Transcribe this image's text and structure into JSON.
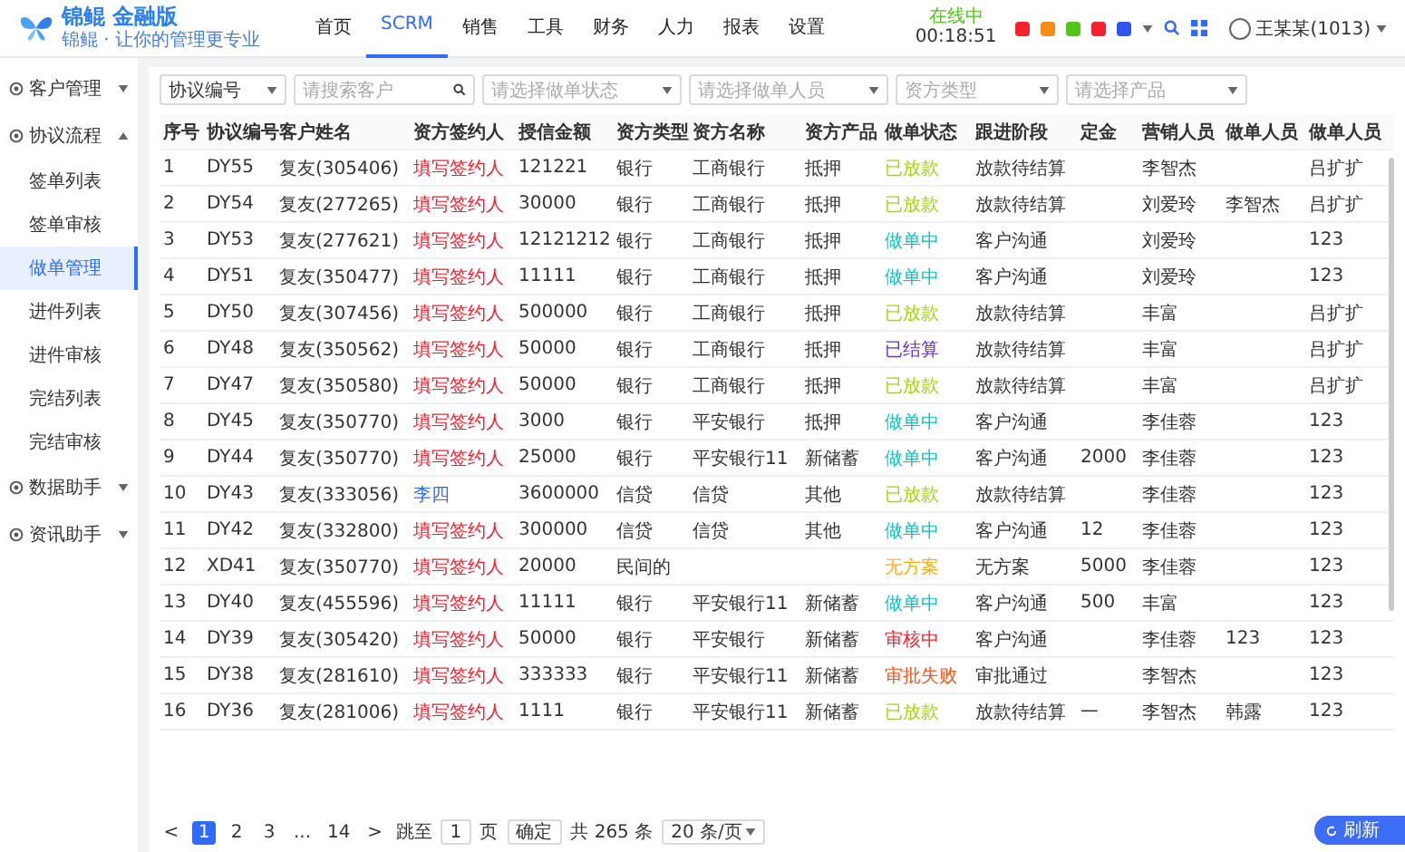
{
  "header": {
    "logo": {
      "name": "锦鲲",
      "edition": "金融版",
      "slogan": "锦鲲 · 让你的管理更专业"
    },
    "nav": [
      {
        "label": "首页",
        "selected": false
      },
      {
        "label": "SCRM",
        "selected": true
      },
      {
        "label": "销售",
        "selected": false
      },
      {
        "label": "工具",
        "selected": false
      },
      {
        "label": "财务",
        "selected": false
      },
      {
        "label": "人力",
        "selected": false
      },
      {
        "label": "报表",
        "selected": false
      },
      {
        "label": "设置",
        "selected": false
      }
    ],
    "status": {
      "label": "在线中",
      "time": "00:18:51"
    },
    "quick_icons": [
      {
        "color": "#f5222d"
      },
      {
        "color": "#fa8c16"
      },
      {
        "color": "#52c41a"
      },
      {
        "color": "#f5222d"
      },
      {
        "color": "#2f54eb"
      }
    ],
    "user": "王某某(1013)"
  },
  "sidebar": [
    {
      "label": "客户管理",
      "expanded": false
    },
    {
      "label": "协议流程",
      "expanded": true,
      "children": [
        {
          "label": "签单列表",
          "selected": false
        },
        {
          "label": "签单审核",
          "selected": false
        },
        {
          "label": "做单管理",
          "selected": true
        },
        {
          "label": "进件列表",
          "selected": false
        },
        {
          "label": "进件审核",
          "selected": false
        },
        {
          "label": "完结列表",
          "selected": false
        },
        {
          "label": "完结审核",
          "selected": false
        }
      ]
    },
    {
      "label": "数据助手",
      "expanded": false
    },
    {
      "label": "资讯助手",
      "expanded": false
    }
  ],
  "filters": [
    {
      "kind": "select",
      "value": "协议编号"
    },
    {
      "kind": "search",
      "placeholder": "请搜索客户"
    },
    {
      "kind": "select",
      "placeholder": "请选择做单状态"
    },
    {
      "kind": "select",
      "placeholder": "请选择做单人员"
    },
    {
      "kind": "select",
      "placeholder": "资方类型"
    },
    {
      "kind": "select",
      "placeholder": "请选择产品"
    }
  ],
  "table": {
    "columns": [
      "序号",
      "协议编号",
      "客户姓名",
      "资方签约人",
      "授信金额",
      "资方类型",
      "资方名称",
      "资方产品",
      "做单状态",
      "跟进阶段",
      "定金",
      "营销人员",
      "做单人员",
      "做单人员"
    ],
    "rows": [
      {
        "cells": [
          "1",
          "DY55",
          "复友(305406)",
          "填写签约人",
          "121221",
          "银行",
          "工商银行",
          "抵押",
          "已放款",
          "放款待结算",
          "",
          "李智杰",
          "",
          "吕扩扩"
        ],
        "signer_filled": false,
        "color": "#a0d911"
      },
      {
        "cells": [
          "2",
          "DY54",
          "复友(277265)",
          "填写签约人",
          "30000",
          "银行",
          "工商银行",
          "抵押",
          "已放款",
          "放款待结算",
          "",
          "刘爱玲",
          "李智杰",
          "吕扩扩"
        ],
        "signer_filled": false,
        "color": "#a0d911"
      },
      {
        "cells": [
          "3",
          "DY53",
          "复友(277621)",
          "填写签约人",
          "12121212",
          "银行",
          "工商银行",
          "抵押",
          "做单中",
          "客户沟通",
          "",
          "刘爱玲",
          "",
          "123"
        ],
        "signer_filled": false,
        "color": "#13c2c2"
      },
      {
        "cells": [
          "4",
          "DY51",
          "复友(350477)",
          "填写签约人",
          "11111",
          "银行",
          "工商银行",
          "抵押",
          "做单中",
          "客户沟通",
          "",
          "刘爱玲",
          "",
          "123"
        ],
        "signer_filled": false,
        "color": "#13c2c2"
      },
      {
        "cells": [
          "5",
          "DY50",
          "复友(307456)",
          "填写签约人",
          "500000",
          "银行",
          "工商银行",
          "抵押",
          "已放款",
          "放款待结算",
          "",
          "丰富",
          "",
          "吕扩扩"
        ],
        "signer_filled": false,
        "color": "#a0d911"
      },
      {
        "cells": [
          "6",
          "DY48",
          "复友(350562)",
          "填写签约人",
          "50000",
          "银行",
          "工商银行",
          "抵押",
          "已结算",
          "放款待结算",
          "",
          "丰富",
          "",
          "吕扩扩"
        ],
        "signer_filled": false,
        "color": "#722ed1"
      },
      {
        "cells": [
          "7",
          "DY47",
          "复友(350580)",
          "填写签约人",
          "50000",
          "银行",
          "工商银行",
          "抵押",
          "已放款",
          "放款待结算",
          "",
          "丰富",
          "",
          "吕扩扩"
        ],
        "signer_filled": false,
        "color": "#a0d911"
      },
      {
        "cells": [
          "8",
          "DY45",
          "复友(350770)",
          "填写签约人",
          "3000",
          "银行",
          "平安银行",
          "抵押",
          "做单中",
          "客户沟通",
          "",
          "李佳蓉",
          "",
          "123"
        ],
        "signer_filled": false,
        "color": "#13c2c2"
      },
      {
        "cells": [
          "9",
          "DY44",
          "复友(350770)",
          "填写签约人",
          "25000",
          "银行",
          "平安银行11",
          "新储蓄",
          "做单中",
          "客户沟通",
          "2000",
          "李佳蓉",
          "",
          "123"
        ],
        "signer_filled": false,
        "color": "#13c2c2"
      },
      {
        "cells": [
          "10",
          "DY43",
          "复友(333056)",
          "李四",
          "3600000",
          "信贷",
          "信贷",
          "其他",
          "已放款",
          "放款待结算",
          "",
          "李佳蓉",
          "",
          "123"
        ],
        "signer_filled": true,
        "color": "#a0d911"
      },
      {
        "cells": [
          "11",
          "DY42",
          "复友(332800)",
          "填写签约人",
          "300000",
          "信贷",
          "信贷",
          "其他",
          "做单中",
          "客户沟通",
          "12",
          "李佳蓉",
          "",
          "123"
        ],
        "signer_filled": false,
        "color": "#13c2c2"
      },
      {
        "cells": [
          "12",
          "XD41",
          "复友(350770)",
          "填写签约人",
          "20000",
          "民间的",
          "",
          "",
          "无方案",
          "无方案",
          "5000",
          "李佳蓉",
          "",
          "123"
        ],
        "signer_filled": false,
        "color": "#faad14"
      },
      {
        "cells": [
          "13",
          "DY40",
          "复友(455596)",
          "填写签约人",
          "11111",
          "银行",
          "平安银行11",
          "新储蓄",
          "做单中",
          "客户沟通",
          "500",
          "丰富",
          "",
          "123"
        ],
        "signer_filled": false,
        "color": "#13c2c2"
      },
      {
        "cells": [
          "14",
          "DY39",
          "复友(305420)",
          "填写签约人",
          "50000",
          "银行",
          "平安银行",
          "新储蓄",
          "审核中",
          "客户沟通",
          "",
          "李佳蓉",
          "123",
          "123"
        ],
        "signer_filled": false,
        "color": "#f5222d"
      },
      {
        "cells": [
          "15",
          "DY38",
          "复友(281610)",
          "填写签约人",
          "333333",
          "银行",
          "平安银行11",
          "新储蓄",
          "审批失败",
          "审批通过",
          "",
          "李智杰",
          "",
          "123"
        ],
        "signer_filled": false,
        "color": "#fa541c"
      },
      {
        "cells": [
          "16",
          "DY36",
          "复友(281006)",
          "填写签约人",
          "1111",
          "银行",
          "平安银行11",
          "新储蓄",
          "已放款",
          "放款待结算",
          "一",
          "李智杰",
          "韩露",
          "123"
        ],
        "signer_filled": false,
        "color": "#a0d911"
      }
    ]
  },
  "pagination": {
    "prev": "<",
    "pages": [
      {
        "label": "1",
        "selected": true
      },
      {
        "label": "2",
        "selected": false
      },
      {
        "label": "3",
        "selected": false
      },
      {
        "label": "...",
        "selected": false
      },
      {
        "label": "14",
        "selected": false
      }
    ],
    "next": ">",
    "jump_label": "跳至",
    "jump_value": "1",
    "page_unit": "页",
    "confirm": "确定",
    "total": "共 265 条",
    "page_size": "20 条/页"
  },
  "refresh_button": "刷新"
}
